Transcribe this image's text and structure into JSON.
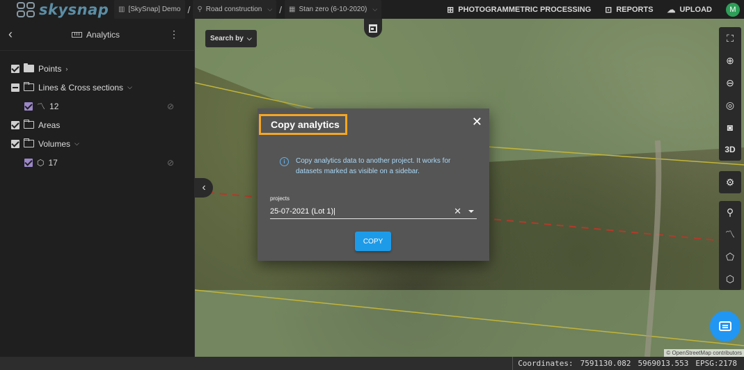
{
  "app": {
    "logo_text": "skysnap",
    "avatar_initial": "M",
    "accent": "#2196f3",
    "highlight": "#f5a623"
  },
  "breadcrumbs": [
    {
      "label": "[SkySnap] Demo",
      "icon": "building-icon"
    },
    {
      "label": "Road construction",
      "icon": "location-pin-icon"
    },
    {
      "label": "Stan zero (6-10-2020)",
      "icon": "calendar-icon"
    }
  ],
  "header_actions": [
    {
      "label": "PHOTOGRAMMETRIC PROCESSING",
      "icon": "image-plus-icon"
    },
    {
      "label": "REPORTS",
      "icon": "report-icon"
    },
    {
      "label": "UPLOAD",
      "icon": "cloud-upload-icon"
    }
  ],
  "sidebar": {
    "title": "Analytics",
    "items": [
      {
        "label": "Points"
      },
      {
        "label": "Lines & Cross sections"
      },
      {
        "label": "12"
      },
      {
        "label": "Areas"
      },
      {
        "label": "Volumes"
      },
      {
        "label": "17"
      }
    ]
  },
  "map": {
    "search_by": "Search by",
    "attribution": "© OpenStreetMap contributors",
    "tools": [
      "fullscreen-icon",
      "zoom-in-icon",
      "zoom-out-icon",
      "locate-icon",
      "camera-icon",
      "3D",
      "settings-icon",
      "pin-icon",
      "polyline-icon",
      "polygon-icon",
      "volume-icon"
    ]
  },
  "status": {
    "coordinates_label": "Coordinates:",
    "x": "7591130.082",
    "y": "5969013.553",
    "epsg": "EPSG:2178"
  },
  "dialog": {
    "title": "Copy analytics",
    "info": "Copy analytics data to another project. It works for datasets marked as visible on a sidebar.",
    "field_label": "projects",
    "field_value": "25-07-2021 (Lot 1)|",
    "button": "COPY"
  }
}
